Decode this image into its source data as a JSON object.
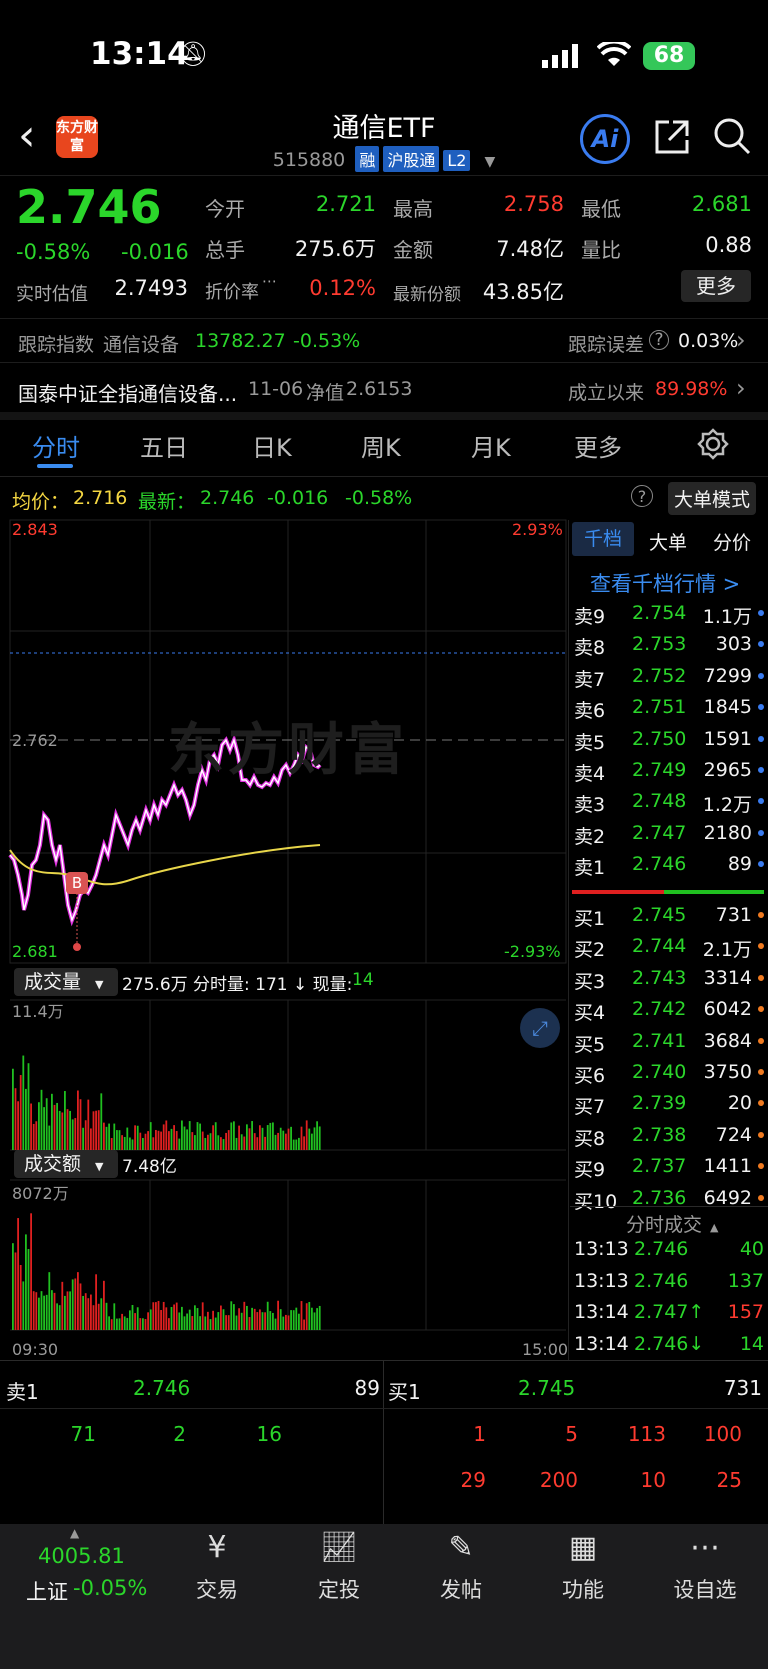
{
  "status": {
    "time": "13:14",
    "battery": "68"
  },
  "header": {
    "title": "通信ETF",
    "code": "515880",
    "tags": [
      "融",
      "沪股通",
      "L2"
    ],
    "logo": "东方财富",
    "ai": "Ai"
  },
  "quote": {
    "price": "2.746",
    "change_pct": "-0.58%",
    "change": "-0.016",
    "est_label": "实时估值",
    "est_value": "2.7493",
    "open_label": "今开",
    "open": "2.721",
    "high_label": "最高",
    "high": "2.758",
    "low_label": "最低",
    "low": "2.681",
    "vol_label": "总手",
    "vol": "275.6万",
    "amt_label": "金额",
    "amt": "7.48亿",
    "ratio_label": "量比",
    "ratio": "0.88",
    "disc_label": "折价率",
    "disc": "0.12%",
    "shares_label": "最新份额",
    "shares": "43.85亿",
    "more": "更多"
  },
  "tracking": {
    "label": "跟踪指数",
    "index": "通信设备",
    "value": "13782.27",
    "pct": "-0.53%",
    "err_label": "跟踪误差",
    "err": "0.03%"
  },
  "fund": {
    "name": "国泰中证全指通信设备...",
    "date": "11-06",
    "nav_label": "净值",
    "nav": "2.6153",
    "since_label": "成立以来",
    "since": "89.98%"
  },
  "tabs": [
    "分时",
    "五日",
    "日K",
    "周K",
    "月K",
    "更多"
  ],
  "chart": {
    "avg_label": "均价：",
    "avg": "2.716",
    "latest_label": "最新：",
    "latest": "2.746",
    "chg": "-0.016",
    "pct": "-0.58%",
    "mode": "大单模式",
    "y_top": "2.843",
    "y_mid": "2.762",
    "y_bot": "2.681",
    "pct_top": "2.93%",
    "pct_bot": "-2.93%",
    "watermark": "东方财富",
    "vol_label": "成交量",
    "vol_total": "275.6万",
    "vol_detail": "分时量: 171 ↓ 现量:",
    "vol_now": "14",
    "vol_max": "11.4万",
    "amt_label": "成交额",
    "amt_total": "7.48亿",
    "amt_max": "8072万",
    "t_start": "09:30",
    "t_end": "15:00",
    "marker": "B"
  },
  "orderbook": {
    "tabs": [
      "千档",
      "大单",
      "分价"
    ],
    "link": "查看千档行情 >",
    "asks": [
      {
        "label": "卖9",
        "price": "2.754",
        "qty": "1.1万"
      },
      {
        "label": "卖8",
        "price": "2.753",
        "qty": "303"
      },
      {
        "label": "卖7",
        "price": "2.752",
        "qty": "7299"
      },
      {
        "label": "卖6",
        "price": "2.751",
        "qty": "1845"
      },
      {
        "label": "卖5",
        "price": "2.750",
        "qty": "1591"
      },
      {
        "label": "卖4",
        "price": "2.749",
        "qty": "2965"
      },
      {
        "label": "卖3",
        "price": "2.748",
        "qty": "1.2万"
      },
      {
        "label": "卖2",
        "price": "2.747",
        "qty": "2180"
      },
      {
        "label": "卖1",
        "price": "2.746",
        "qty": "89"
      }
    ],
    "bids": [
      {
        "label": "买1",
        "price": "2.745",
        "qty": "731"
      },
      {
        "label": "买2",
        "price": "2.744",
        "qty": "2.1万"
      },
      {
        "label": "买3",
        "price": "2.743",
        "qty": "3314"
      },
      {
        "label": "买4",
        "price": "2.742",
        "qty": "6042"
      },
      {
        "label": "买5",
        "price": "2.741",
        "qty": "3684"
      },
      {
        "label": "买6",
        "price": "2.740",
        "qty": "3750"
      },
      {
        "label": "买7",
        "price": "2.739",
        "qty": "20"
      },
      {
        "label": "买8",
        "price": "2.738",
        "qty": "724"
      },
      {
        "label": "买9",
        "price": "2.737",
        "qty": "1411"
      },
      {
        "label": "买10",
        "price": "2.736",
        "qty": "6492"
      }
    ],
    "trades_label": "分时成交",
    "trades": [
      {
        "time": "13:13",
        "price": "2.746",
        "vol": "40",
        "color": "green",
        "arrow": ""
      },
      {
        "time": "13:13",
        "price": "2.746",
        "vol": "137",
        "color": "green",
        "arrow": ""
      },
      {
        "time": "13:14",
        "price": "2.747↑",
        "vol": "157",
        "color": "red",
        "arrow": "up"
      },
      {
        "time": "13:14",
        "price": "2.746↓",
        "vol": "14",
        "color": "green",
        "arrow": "down"
      }
    ]
  },
  "queue": {
    "sell_label": "卖1",
    "sell_price": "2.746",
    "sell_qty": "89",
    "buy_label": "买1",
    "buy_price": "2.745",
    "buy_qty": "731",
    "sell_orders": [
      "71",
      "2",
      "16"
    ],
    "buy_orders_row1": [
      "1",
      "5",
      "113",
      "100"
    ],
    "buy_orders_row2": [
      "29",
      "200",
      "10",
      "25"
    ]
  },
  "bottom_nav": {
    "index_value": "4005.81",
    "index_name": "上证",
    "index_pct": "-0.05%",
    "items": [
      "交易",
      "定投",
      "发帖",
      "功能",
      "设自选"
    ]
  }
}
